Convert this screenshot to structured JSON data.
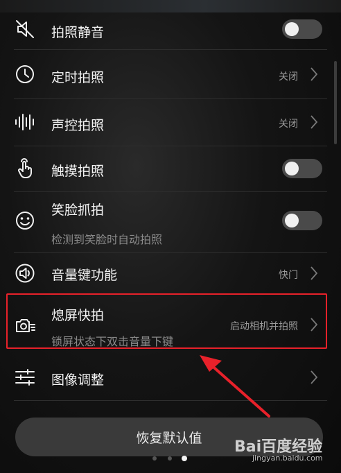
{
  "settings": {
    "items": [
      {
        "title": "拍照静音",
        "type": "toggle",
        "on": false,
        "icon": "speaker-mute-icon"
      },
      {
        "title": "定时拍照",
        "value": "关闭",
        "icon": "clock-icon"
      },
      {
        "title": "声控拍照",
        "value": "关闭",
        "icon": "sound-wave-icon"
      },
      {
        "title": "触摸拍照",
        "type": "toggle",
        "on": false,
        "icon": "touch-icon"
      },
      {
        "title": "笑脸抓拍",
        "subtitle": "检测到笑脸时自动拍照",
        "type": "toggle",
        "on": false,
        "icon": "smile-icon"
      },
      {
        "title": "音量键功能",
        "value": "快门",
        "icon": "speaker-icon"
      },
      {
        "title": "熄屏快拍",
        "subtitle": "锁屏状态下双击音量下键",
        "value": "启动相机并拍照",
        "icon": "camera-quick-icon"
      },
      {
        "title": "图像调整",
        "icon": "sliders-icon"
      }
    ]
  },
  "reset_button": {
    "label": "恢复默认值"
  },
  "page_indicator": {
    "count": 3,
    "active": 3
  },
  "watermark": {
    "brand": "Bai百度经验",
    "url": "jingyan.baidu.com"
  },
  "colors": {
    "highlight": "#e8212a",
    "background": "#0b0b0b",
    "toggle_off": "#4a4a4a"
  }
}
